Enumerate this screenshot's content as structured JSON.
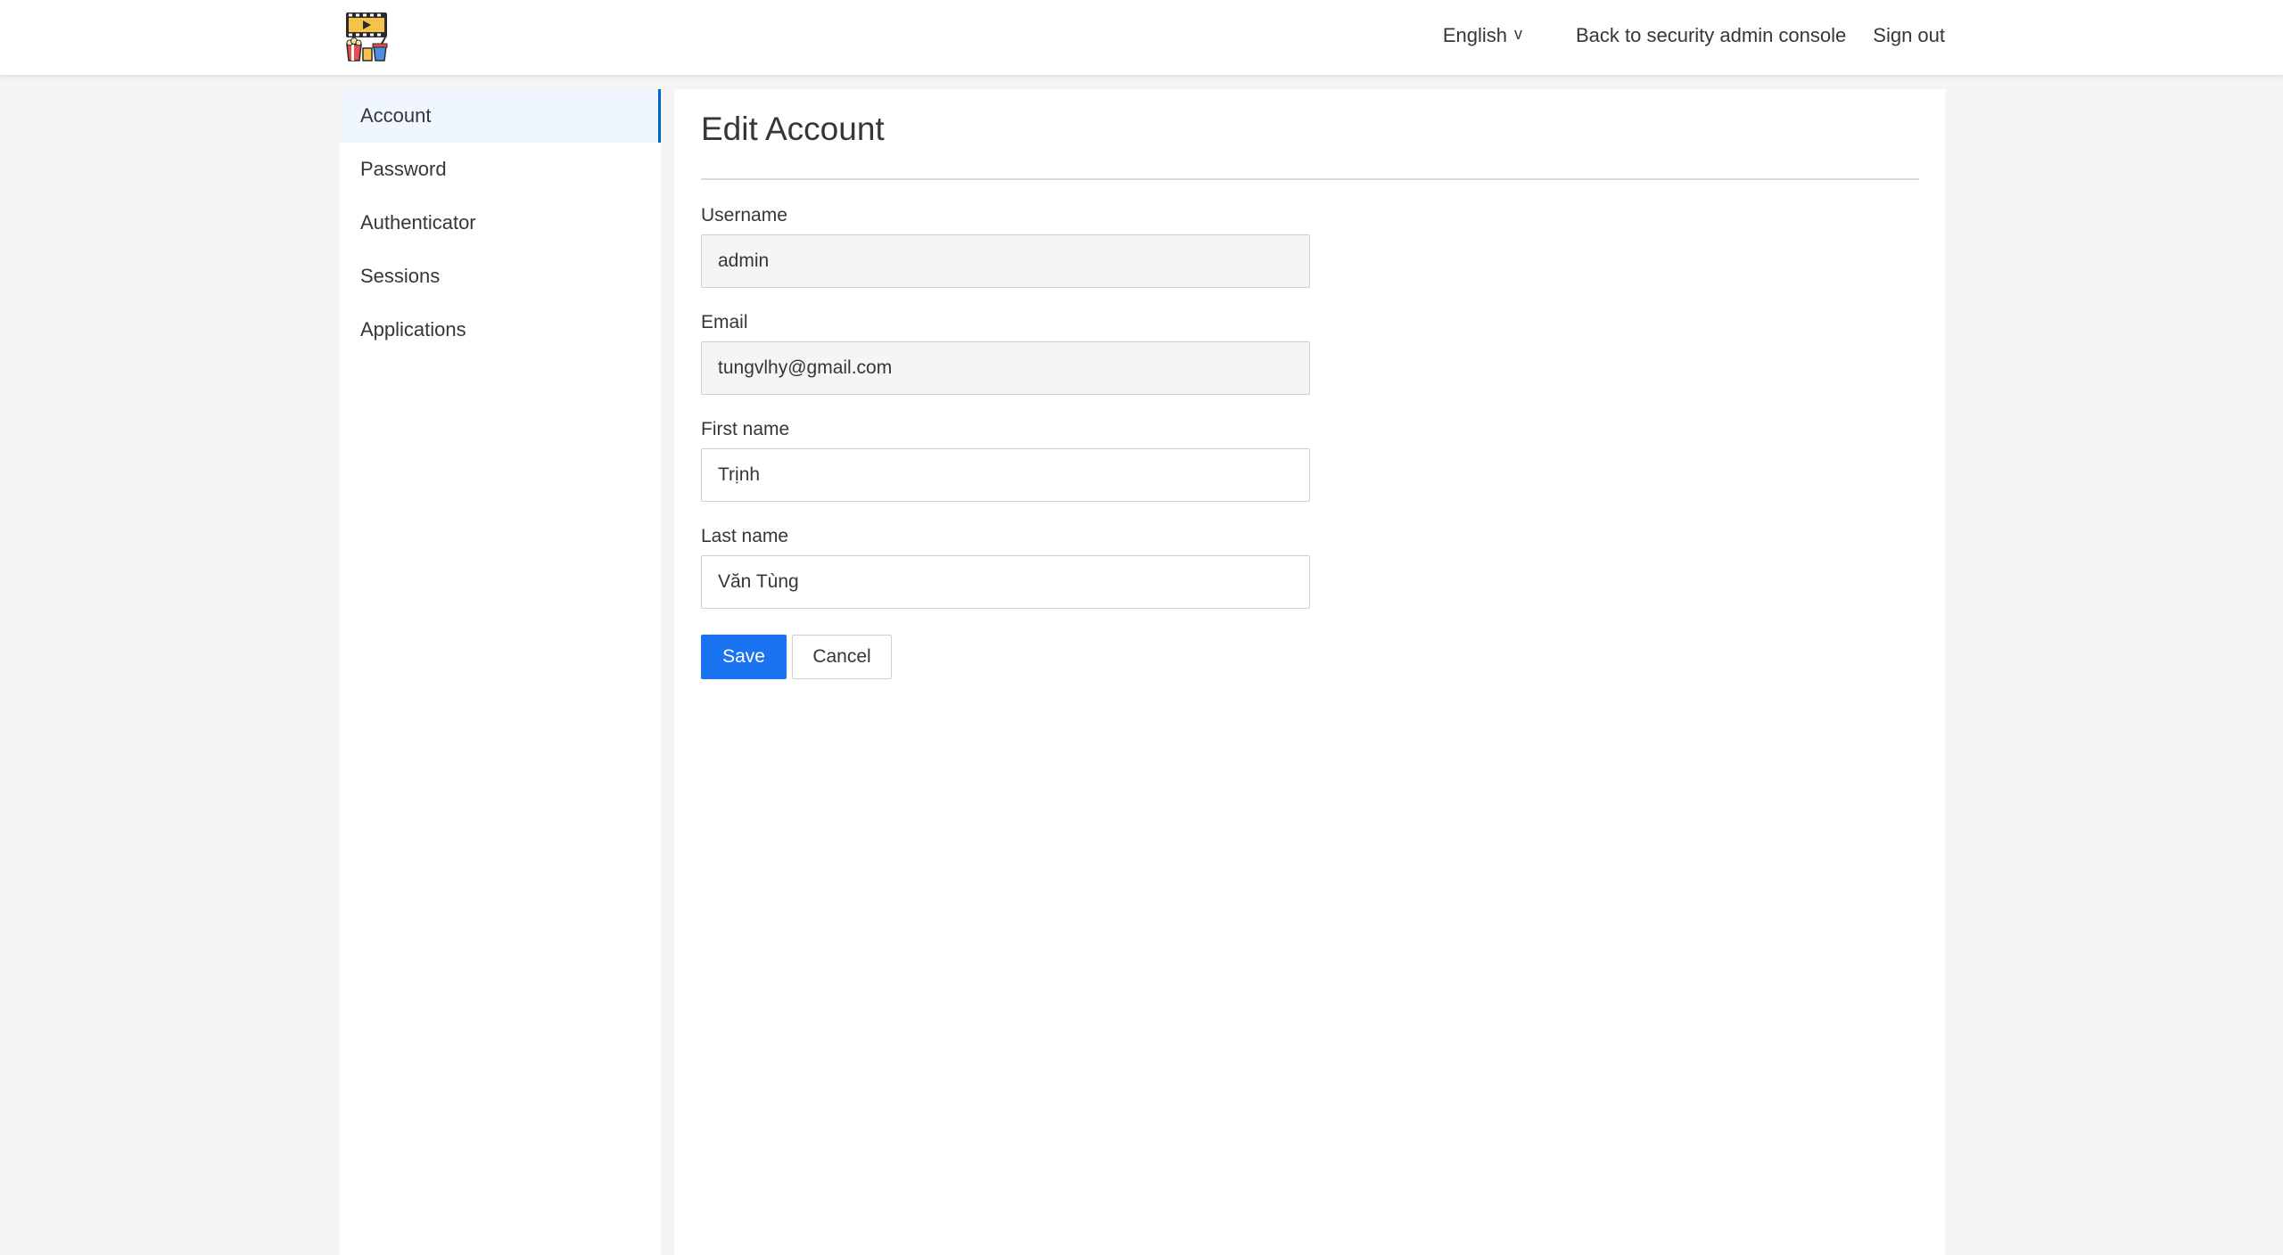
{
  "header": {
    "logo_name": "cinema-logo",
    "language": "English",
    "language_chevron": "v",
    "back_link": "Back to security admin console",
    "sign_out": "Sign out"
  },
  "sidebar": {
    "items": [
      {
        "label": "Account",
        "active": true
      },
      {
        "label": "Password",
        "active": false
      },
      {
        "label": "Authenticator",
        "active": false
      },
      {
        "label": "Sessions",
        "active": false
      },
      {
        "label": "Applications",
        "active": false
      }
    ]
  },
  "main": {
    "title": "Edit Account",
    "fields": {
      "username": {
        "label": "Username",
        "value": "admin",
        "readonly": true
      },
      "email": {
        "label": "Email",
        "value": "tungvlhy@gmail.com",
        "readonly": true
      },
      "first_name": {
        "label": "First name",
        "value": "Trịnh",
        "readonly": false
      },
      "last_name": {
        "label": "Last name",
        "value": "Văn Tùng",
        "readonly": false
      }
    },
    "save_label": "Save",
    "cancel_label": "Cancel"
  },
  "colors": {
    "accent": "#1a73f0",
    "active_indicator": "#0066cc",
    "active_bg": "#f0f6fd",
    "page_bg": "#f5f5f5"
  }
}
